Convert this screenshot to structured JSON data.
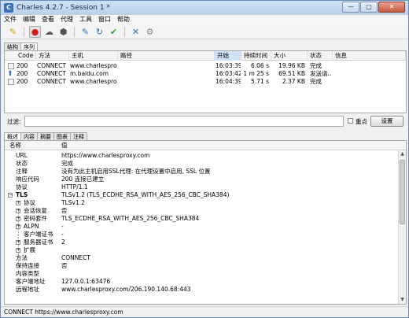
{
  "window": {
    "title": "Charles 4.2.7 - Session 1 *",
    "icon_label": "C",
    "minimize": "—",
    "maximize": "□",
    "close": "✕"
  },
  "menu": [
    "文件",
    "编辑",
    "查看",
    "代理",
    "工具",
    "窗口",
    "帮助"
  ],
  "toolbar": {
    "icons": [
      "broom-icon",
      "record-icon",
      "throttle-turtle-icon",
      "breakpoint-hexagon-icon",
      "compose-pen-icon",
      "refresh-icon",
      "validate-check-icon",
      "tools-icon",
      "settings-gear-icon"
    ],
    "glyphs": [
      "✎",
      "●",
      "☁",
      "⬢",
      "✎",
      "↻",
      "✔",
      "✕",
      "⚙"
    ]
  },
  "view_tabs": [
    "结构",
    "序列"
  ],
  "sequence": {
    "columns": [
      "Code",
      "方法",
      "主机",
      "路径",
      "开始",
      "持续时间",
      "大小",
      "状态",
      "信息"
    ],
    "rows": [
      {
        "code": "200",
        "method": "CONNECT",
        "host": "www.charlesproxy....",
        "path": "",
        "start": "16:03:39",
        "duration": "6.06 s",
        "size": "19.96 KB",
        "status": "完成",
        "info": ""
      },
      {
        "code": "200",
        "method": "CONNECT",
        "host": "m.baidu.com",
        "path": "",
        "start": "16:03:42",
        "duration": "1 m 25 s",
        "size": "69.51 KB",
        "status": "发送请...",
        "info": ""
      },
      {
        "code": "200",
        "method": "CONNECT",
        "host": "www.charlesproxy....",
        "path": "",
        "start": "16:04:39",
        "duration": "5.71 s",
        "size": "2.37 KB",
        "status": "完成",
        "info": ""
      }
    ]
  },
  "filter": {
    "label": "过滤:",
    "value": "",
    "focus_label": "重点",
    "settings_button": "设置"
  },
  "detail_tabs": [
    "概述",
    "内容",
    "摘要",
    "图表",
    "注释"
  ],
  "detail": {
    "header_name": "名称",
    "header_value": "值",
    "rows": [
      {
        "key": "URL",
        "value": "https://www.charlesproxy.com"
      },
      {
        "key": "状态",
        "value": "完成"
      },
      {
        "key": "注释",
        "value": "没有为此主机启用SSL代理: 在代理设置中启用, SSL 位置"
      },
      {
        "key": "响应代码",
        "value": "200 连接已建立"
      },
      {
        "key": "协议",
        "value": "HTTP/1.1"
      },
      {
        "key": "TLS",
        "value": "TLSv1.2 (TLS_ECDHE_RSA_WITH_AES_256_CBC_SHA384)"
      },
      {
        "key": "协议",
        "value": "TLSv1.2"
      },
      {
        "key": "会话恢复",
        "value": "否"
      },
      {
        "key": "密码套件",
        "value": "TLS_ECDHE_RSA_WITH_AES_256_CBC_SHA384"
      },
      {
        "key": "ALPN",
        "value": "-"
      },
      {
        "key": "客户端证书",
        "value": "-"
      },
      {
        "key": "服务器证书",
        "value": "2"
      },
      {
        "key": "扩展",
        "value": ""
      },
      {
        "key": "方法",
        "value": "CONNECT"
      },
      {
        "key": "保持连接",
        "value": "否"
      },
      {
        "key": "内容类型",
        "value": ""
      },
      {
        "key": "客户端地址",
        "value": "127.0.0.1:63476"
      },
      {
        "key": "远程地址",
        "value": "www.charlesproxy.com/206.190.140.68:443"
      }
    ]
  },
  "status_bar": "CONNECT https://www.charlesproxy.com"
}
